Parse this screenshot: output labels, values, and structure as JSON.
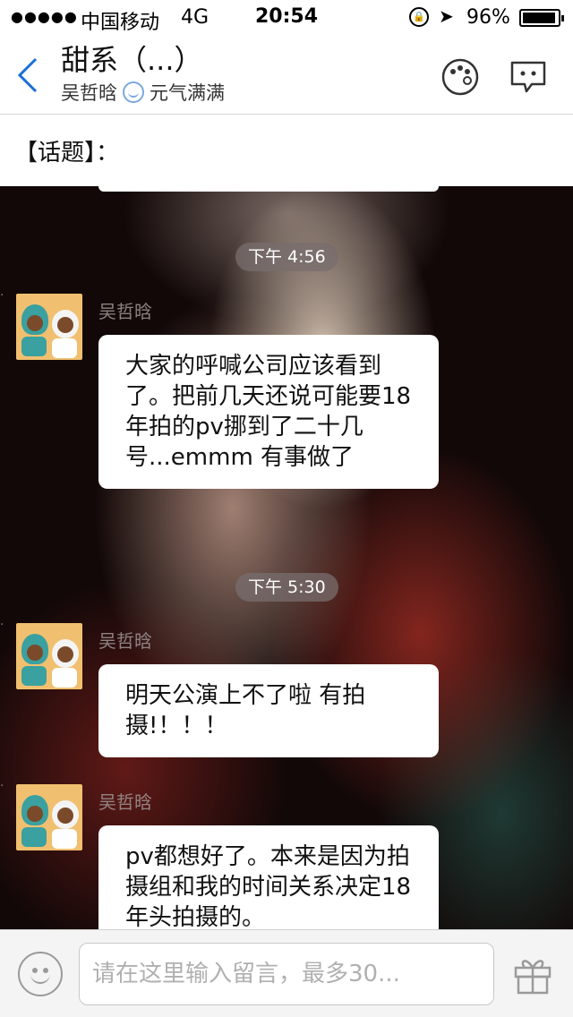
{
  "status_bar": {
    "signal": "●●●●●",
    "carrier": "中国移动",
    "network": "4G",
    "time": "20:54",
    "battery_text": "96%",
    "battery_level": 0.96
  },
  "header": {
    "title": "甜系（...）",
    "subtitle_name": "吴哲晗",
    "subtitle_status": "元气满满"
  },
  "topic": {
    "label": "【话题】："
  },
  "messages": [
    {
      "time": "下午 4:56",
      "sender": "吴哲晗",
      "text": "大家的呼喊公司应该看到了。把前几天还说可能要18年拍的pv挪到了二十几号...emmm 有事做了"
    },
    {
      "time": "下午 5:30",
      "sender": "吴哲晗",
      "text": "明天公演上不了啦 有拍摄!！！！"
    },
    {
      "sender": "吴哲晗",
      "text": "pv都想好了。本来是因为拍摄组和我的时间关系决定18年头拍摄的。"
    }
  ],
  "input": {
    "placeholder": "请在这里输入留言，最多30..."
  }
}
